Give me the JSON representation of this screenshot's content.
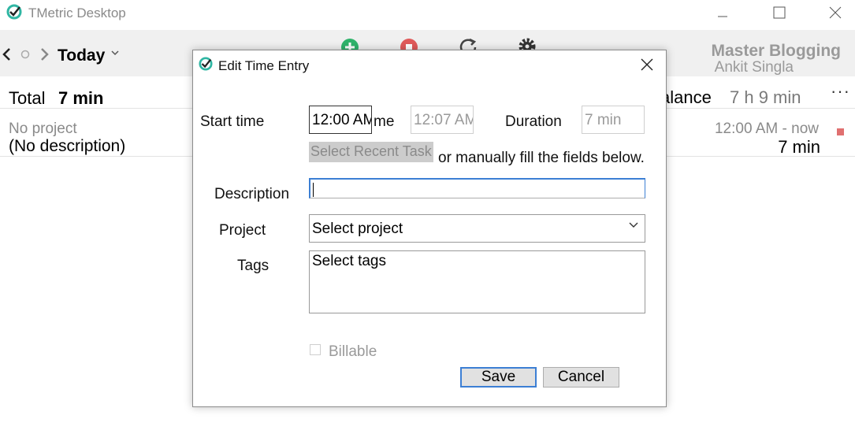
{
  "window": {
    "title": "TMetric Desktop"
  },
  "toolbar": {
    "period_label": "Today",
    "workspace_name": "Master Blogging",
    "user_name": "Ankit Singla"
  },
  "summary": {
    "total_label": "Total",
    "total_value": "7 min",
    "balance_label": "alance",
    "balance_value": "7 h 9 min",
    "more_label": "···"
  },
  "entry": {
    "project": "No project",
    "description": "(No description)",
    "time_range": "12:00 AM - now",
    "duration": "7 min"
  },
  "dialog": {
    "title": "Edit Time Entry",
    "start_time_label": "Start time",
    "start_time_value": "12:00 AM",
    "partial_label": "me",
    "end_time_value": "12:07 AM",
    "duration_label": "Duration",
    "duration_value": "7 min",
    "recent_task_button": "Select Recent Task",
    "manual_hint": "or manually fill the fields below.",
    "description_label": "Description",
    "description_value": "",
    "project_label": "Project",
    "project_placeholder": "Select project",
    "tags_label": "Tags",
    "tags_placeholder": "Select tags",
    "billable_label": "Billable",
    "save_label": "Save",
    "cancel_label": "Cancel"
  },
  "colors": {
    "accent": "#3c7fd4",
    "start_green": "#2fb36b",
    "stop_red": "#e05a5a",
    "stop_square": "#e07070"
  }
}
